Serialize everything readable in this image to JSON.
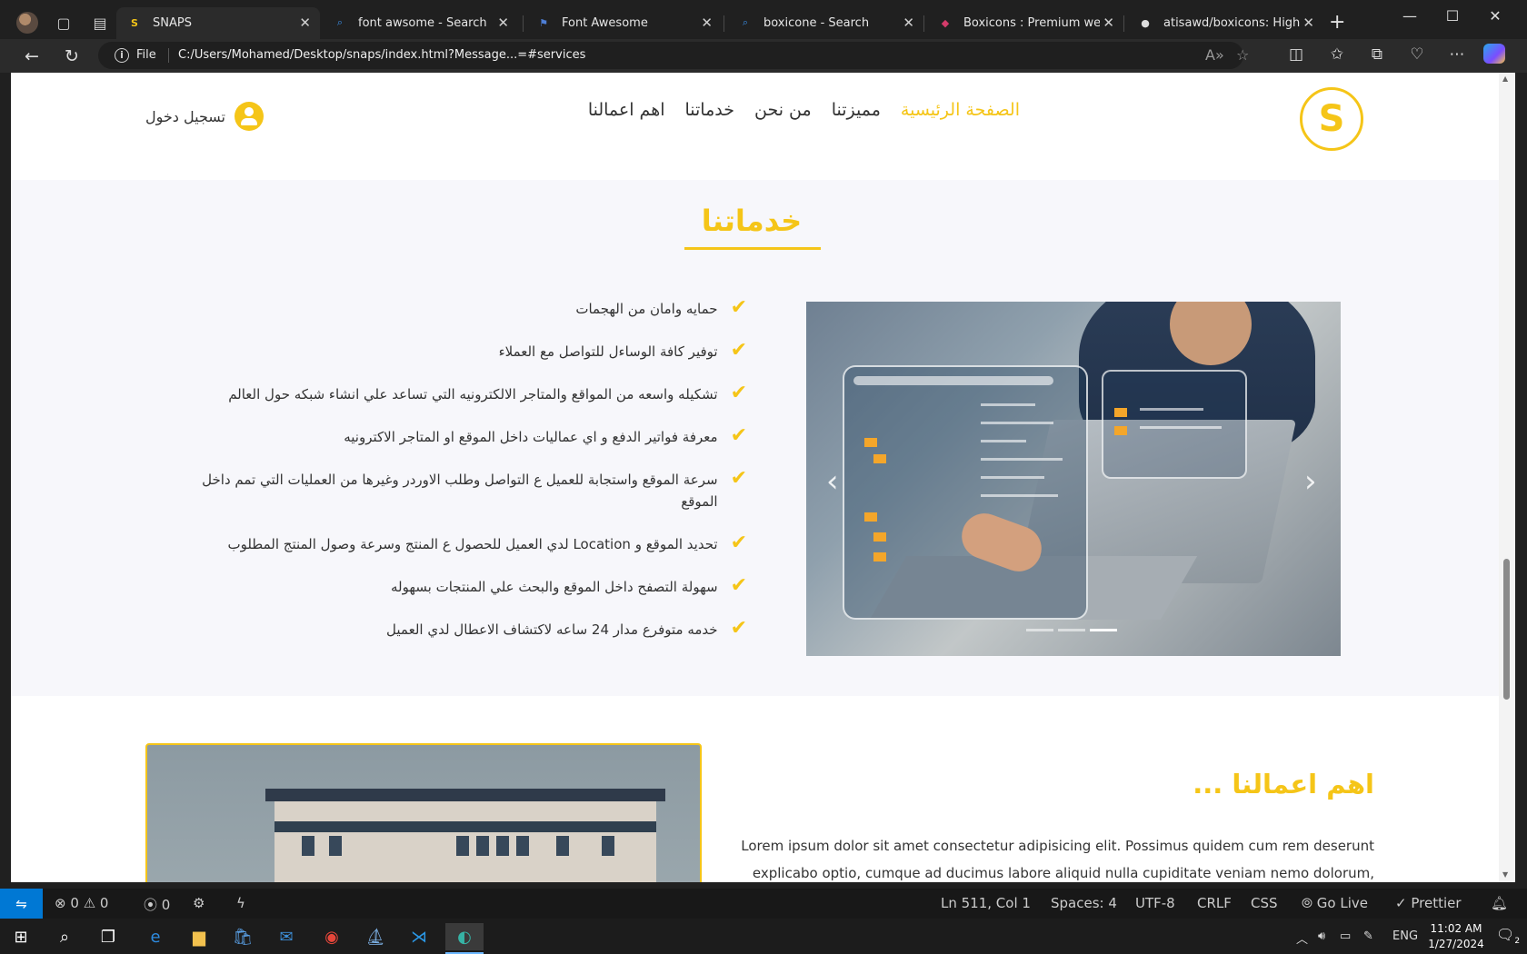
{
  "browser": {
    "tabs": [
      {
        "title": "SNAPS",
        "favicon": "snaps-logo-icon",
        "active": true
      },
      {
        "title": "font awsome - Search",
        "favicon": "search-icon",
        "active": false
      },
      {
        "title": "Font Awesome",
        "favicon": "flag-icon",
        "active": false
      },
      {
        "title": "boxicone - Search",
        "favicon": "search-icon",
        "active": false
      },
      {
        "title": "Boxicons : Premium web frier",
        "favicon": "boxicons-icon",
        "active": false
      },
      {
        "title": "atisawd/boxicons: High Qual",
        "favicon": "github-icon",
        "active": false
      }
    ],
    "address": {
      "scheme_label": "File",
      "url": "C:/Users/Mohamed/Desktop/snaps/index.html?Message...=#services"
    }
  },
  "site": {
    "logo_text": "S",
    "nav": [
      {
        "label": "الصفحة الرئيسية",
        "active": true
      },
      {
        "label": "مميزتنا",
        "active": false
      },
      {
        "label": "من نحن",
        "active": false
      },
      {
        "label": "خدماتنا",
        "active": false
      },
      {
        "label": "اهم اعمالنا",
        "active": false
      }
    ],
    "login_label": "تسجيل دخول",
    "services": {
      "title": "خدماتنا",
      "items": [
        "حمايه وامان من الهجمات",
        "توفير كافة الوساءل للتواصل مع العملاء",
        "تشكيله واسعه من المواقع والمتاجر الالكترونيه التي تساعد علي انشاء شبكه حول العالم",
        "معرفة فواتير الدفع و اي عماليات داخل الموقع او المتاجر الاكترونيه",
        "سرعة الموقع واستجابة للعميل ع التواصل وطلب الاوردر وغيرها من العمليات التي تمم داخل الموقع",
        "تحديد الموقع و Location لدي العميل للحصول ع المنتج وسرعة وصول المنتج المطلوب",
        "سهولة التصفح داخل الموقع والبحث علي المنتجات بسهوله",
        "خدمه متوفرع مدار 24 ساعه لاكتشاف الاعطال لدي العميل"
      ],
      "carousel": {
        "slide_count": 3,
        "active_slide": 3,
        "prev_glyph": "‹",
        "next_glyph": "›"
      }
    },
    "works": {
      "title": "اهم اعمالنا ...",
      "text_line1": "Lorem ipsum dolor sit amet consectetur adipisicing elit. Possimus quidem cum rem deserunt",
      "text_line2": "explicabo optio, cumque ad ducimus labore aliquid nulla cupiditate veniam nemo dolorum,"
    }
  },
  "vscode_status": {
    "errors": "0",
    "warnings": "0",
    "ports": "0",
    "position": "Ln 511, Col 1",
    "spaces": "Spaces: 4",
    "encoding": "UTF-8",
    "eol": "CRLF",
    "language": "CSS",
    "go_live": "Go Live",
    "prettier": "Prettier"
  },
  "taskbar": {
    "language": "ENG",
    "time": "11:02 AM",
    "date": "1/27/2024",
    "notification_count": "2"
  },
  "colors": {
    "accent": "#f5c518",
    "vscode_remote": "#0078d4",
    "page_section_bg": "#f7f7fb"
  }
}
